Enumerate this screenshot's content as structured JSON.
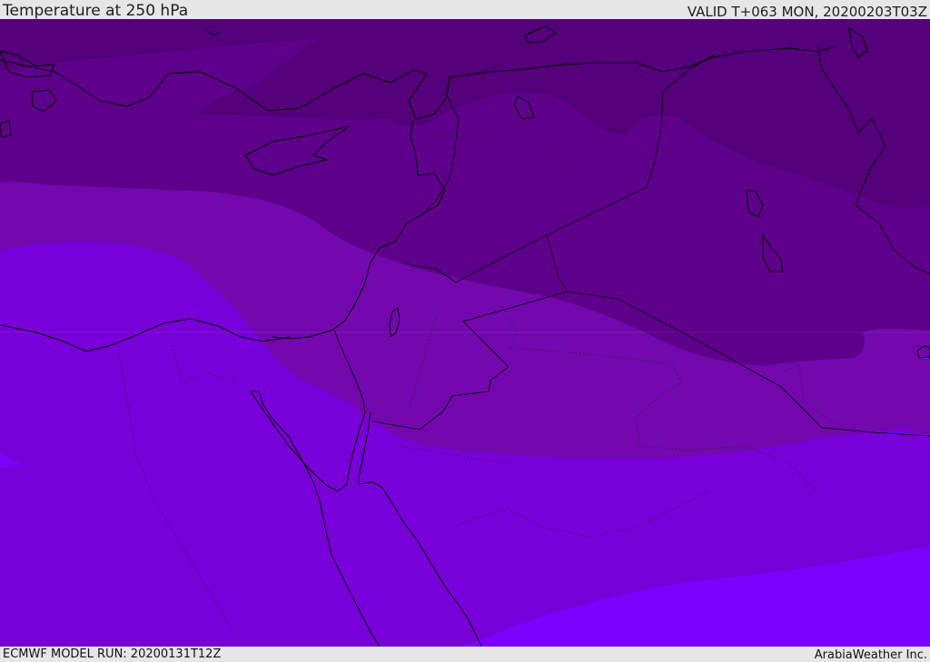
{
  "header": {
    "title": "Temperature at 250 hPa",
    "valid": "VALID T+063 MON, 20200203T03Z"
  },
  "footer": {
    "model_run": "ECMWF MODEL RUN: 20200131T12Z",
    "credit": "ArabiaWeather Inc."
  },
  "map": {
    "colors": {
      "band_darkest": "#53007a",
      "band_dark": "#5f008c",
      "band_mid": "#7208ad",
      "band_light": "#7800d8",
      "band_lightest": "#7d00ff",
      "boundary": "#000000"
    }
  }
}
